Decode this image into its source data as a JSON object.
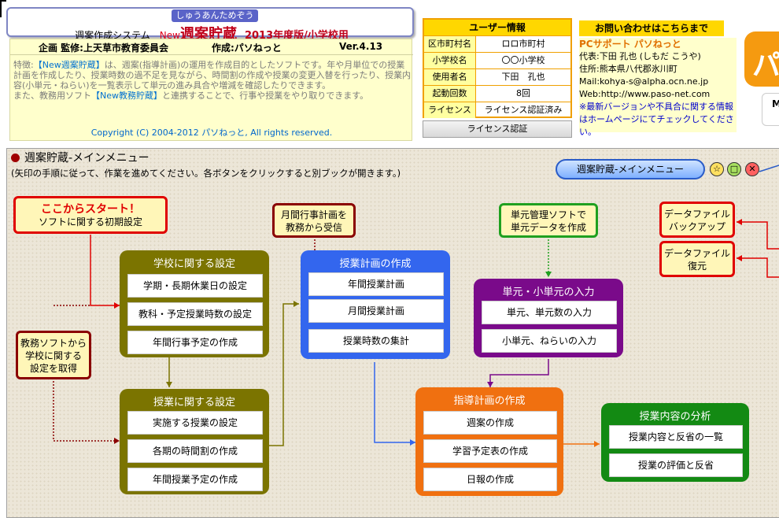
{
  "header": {
    "ruby": "しゅうあんためぞう",
    "system": "週案作成システム",
    "new_tag": "New",
    "app_name": "週案貯蔵",
    "edition": "2013年度版/小学校用",
    "planning": "企画 監修:上天草市教育委員会",
    "author": "作成:パソねっと",
    "version": "Ver.4.13",
    "desc1_prefix": "特徴:",
    "desc1_hl": "【New週案貯蔵】",
    "desc1_rest": "は、週案(指導計画)の運用を作成目的としたソフトです。年や月単位での授業計画を作成したり、授業時数の過不足を見ながら、時間割の作成や授業の変更入替を行ったり、授業内容(小単元・ねらい)を一覧表示して単元の進み具合や増減を確認したりできます。",
    "desc2_prefix": "また、教務用ソフト",
    "desc2_hl": "【New教務貯蔵】",
    "desc2_rest": "と連携することで、行事や授業をやり取りできます。",
    "copyright": "Copyright (C) 2004-2012 パソねっと, All rights reserved."
  },
  "user_info": {
    "title": "ユーザー情報",
    "rows": [
      {
        "label": "区市町村名",
        "value": "ロロ市町村"
      },
      {
        "label": "小学校名",
        "value": "〇〇小学校"
      },
      {
        "label": "使用者名",
        "value": "下田　孔也"
      },
      {
        "label": "起動回数",
        "value": "8回"
      },
      {
        "label": "ライセンス",
        "value": "ライセンス認証済み"
      }
    ],
    "license_button": "ライセンス認証"
  },
  "contact": {
    "title": "お問い合わせはこちらまで",
    "brand": "PCサポート パソねっと",
    "rep": "代表:下田 孔也 (しもだ こうや)",
    "address": "住所:熊本県八代郡氷川町",
    "mail": "Mail:kohya-s@alpha.ocn.ne.jp",
    "web": "Web:http://www.paso-net.com",
    "note": "※最新バージョンや不具合に関する情報はホームページにてチェックしてください。",
    "logo_glyph": "パ",
    "logo_small": "M"
  },
  "menu": {
    "title": "週案貯蔵-メインメニュー",
    "subtitle": "(矢印の手順に従って、作業を進めてください。各ボタンをクリックすると別ブックが開きます。)",
    "main_menu_button": "週案貯蔵-メインメニュー",
    "start_label_1": "ここからスタート！",
    "start_label_2": "ソフトに関する初期設定",
    "monthly_receive_1": "月間行事計画を",
    "monthly_receive_2": "教務から受信",
    "unit_soft_1": "単元管理ソフトで",
    "unit_soft_2": "単元データを作成",
    "kyomu_1": "教務ソフトから",
    "kyomu_2": "学校に関する",
    "kyomu_3": "設定を取得",
    "backup_1": "データファイル",
    "backup_2": "バックアップ",
    "restore_1": "データファイル",
    "restore_2": "復元",
    "groups": {
      "school": {
        "title": "学校に関する設定",
        "items": [
          "学期・長期休業日の設定",
          "教科・予定授業時数の設定",
          "年間行事予定の作成"
        ]
      },
      "lesson": {
        "title": "授業に関する設定",
        "items": [
          "実施する授業の設定",
          "各期の時間割の作成",
          "年間授業予定の作成"
        ]
      },
      "plan": {
        "title": "授業計画の作成",
        "items": [
          "年間授業計画",
          "月間授業計画",
          "授業時数の集計"
        ]
      },
      "unit": {
        "title": "単元・小単元の入力",
        "items": [
          "単元、単元数の入力",
          "小単元、ねらいの入力"
        ]
      },
      "guide": {
        "title": "指導計画の作成",
        "items": [
          "週案の作成",
          "学習予定表の作成",
          "日報の作成"
        ]
      },
      "analysis": {
        "title": "授業内容の分析",
        "items": [
          "授業内容と反省の一覧",
          "授業の評価と反省"
        ]
      }
    }
  },
  "colors": {
    "school": "#7b7400",
    "lesson": "#7b7400",
    "plan": "#3366ee",
    "unit": "#7a0a8a",
    "guide": "#f07010",
    "analysis": "#138a13"
  }
}
